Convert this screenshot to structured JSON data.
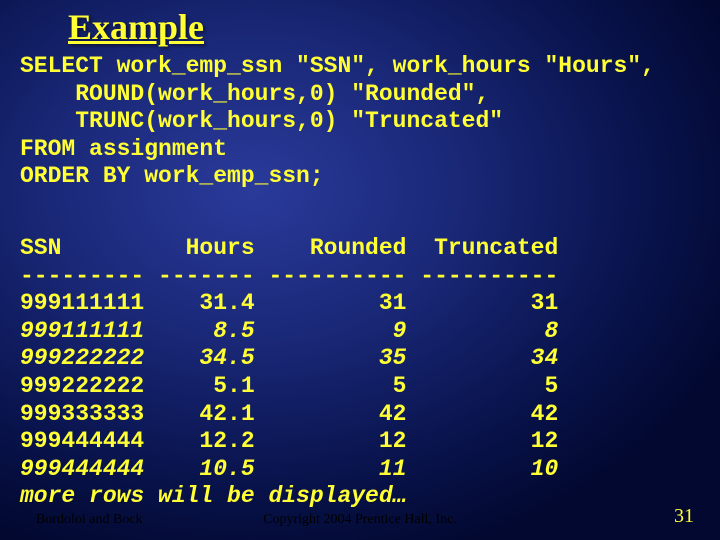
{
  "title": "Example",
  "sql": {
    "l1": "SELECT work_emp_ssn \"SSN\", work_hours \"Hours\",",
    "l2": "    ROUND(work_hours,0) \"Rounded\",",
    "l3": "    TRUNC(work_hours,0) \"Truncated\"",
    "l4": "FROM assignment",
    "l5": "ORDER BY work_emp_ssn;"
  },
  "table": {
    "header": "SSN         Hours    Rounded  Truncated",
    "divider": "--------- ------- ---------- ----------",
    "r1": "999111111    31.4         31         31",
    "r2": "999111111     8.5          9          8",
    "r3": "999222222    34.5         35         34",
    "r4": "999222222     5.1          5          5",
    "r5": "999333333    42.1         42         42",
    "r6": "999444444    12.2         12         12",
    "r7": "999444444    10.5         11         10",
    "more": "more rows will be displayed…"
  },
  "footer": {
    "left": "Bordoloi and Bock",
    "center": "Copyright 2004 Prentice Hall, Inc.",
    "right": "31"
  },
  "chart_data": {
    "type": "table",
    "title": "Example",
    "columns": [
      "SSN",
      "Hours",
      "Rounded",
      "Truncated"
    ],
    "rows": [
      [
        "999111111",
        31.4,
        31,
        31
      ],
      [
        "999111111",
        8.5,
        9,
        8
      ],
      [
        "999222222",
        34.5,
        35,
        34
      ],
      [
        "999222222",
        5.1,
        5,
        5
      ],
      [
        "999333333",
        42.1,
        42,
        42
      ],
      [
        "999444444",
        12.2,
        12,
        12
      ],
      [
        "999444444",
        10.5,
        11,
        10
      ]
    ],
    "note": "more rows will be displayed…"
  }
}
